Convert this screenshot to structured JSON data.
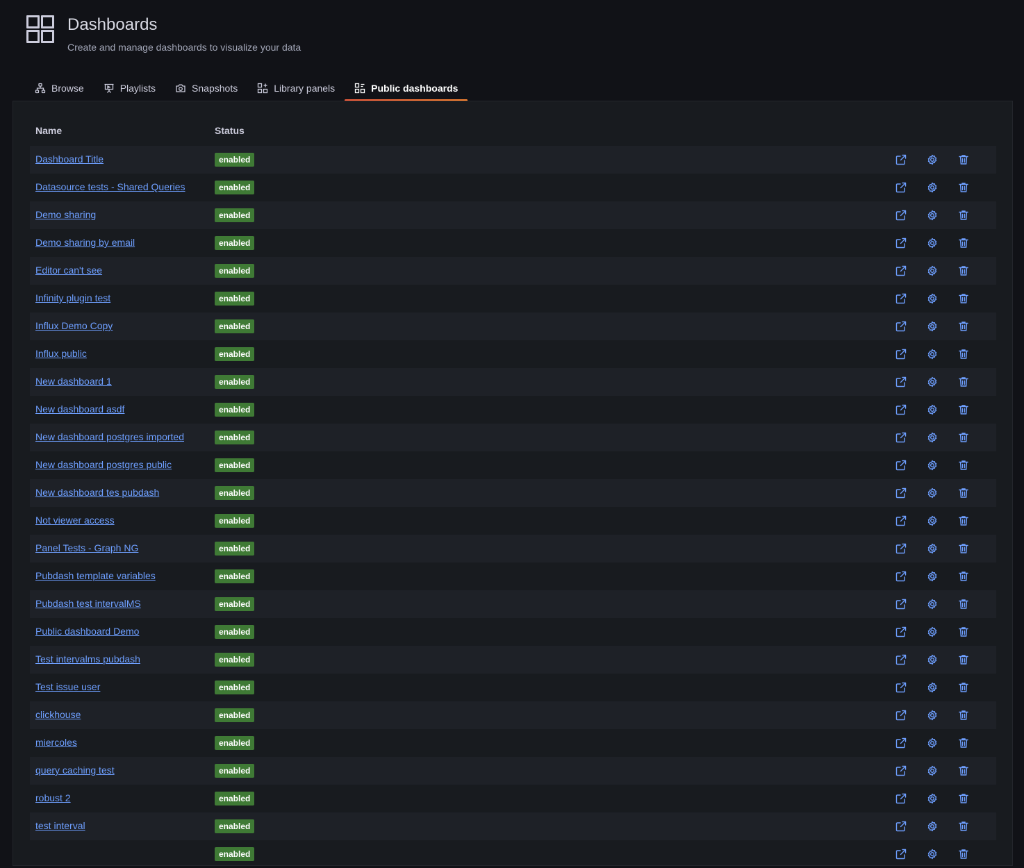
{
  "header": {
    "title": "Dashboards",
    "subtitle": "Create and manage dashboards to visualize your data",
    "icon": "apps-grid-icon"
  },
  "tabs": [
    {
      "label": "Browse",
      "icon": "sitemap-icon",
      "active": false
    },
    {
      "label": "Playlists",
      "icon": "presentation-icon",
      "active": false
    },
    {
      "label": "Snapshots",
      "icon": "camera-icon",
      "active": false
    },
    {
      "label": "Library panels",
      "icon": "library-panel-icon",
      "active": false
    },
    {
      "label": "Public dashboards",
      "icon": "public-dashboard-icon",
      "active": true
    }
  ],
  "table": {
    "columns": {
      "name": "Name",
      "status": "Status"
    },
    "rows": [
      {
        "name": "Dashboard Title",
        "status": "enabled"
      },
      {
        "name": "Datasource tests - Shared Queries",
        "status": "enabled"
      },
      {
        "name": "Demo sharing",
        "status": "enabled"
      },
      {
        "name": "Demo sharing by email",
        "status": "enabled"
      },
      {
        "name": "Editor can't see",
        "status": "enabled"
      },
      {
        "name": "Infinity plugin test",
        "status": "enabled"
      },
      {
        "name": "Influx Demo Copy",
        "status": "enabled"
      },
      {
        "name": "Influx public",
        "status": "enabled"
      },
      {
        "name": "New dashboard 1",
        "status": "enabled"
      },
      {
        "name": "New dashboard asdf",
        "status": "enabled"
      },
      {
        "name": "New dashboard postgres imported",
        "status": "enabled"
      },
      {
        "name": "New dashboard postgres public",
        "status": "enabled"
      },
      {
        "name": "New dashboard tes pubdash",
        "status": "enabled"
      },
      {
        "name": "Not viewer access",
        "status": "enabled"
      },
      {
        "name": "Panel Tests - Graph NG",
        "status": "enabled"
      },
      {
        "name": "Pubdash template variables",
        "status": "enabled"
      },
      {
        "name": "Pubdash test intervalMS",
        "status": "enabled"
      },
      {
        "name": "Public dashboard Demo",
        "status": "enabled"
      },
      {
        "name": "Test intervalms pubdash",
        "status": "enabled"
      },
      {
        "name": "Test issue user",
        "status": "enabled"
      },
      {
        "name": "clickhouse",
        "status": "enabled"
      },
      {
        "name": "miercoles",
        "status": "enabled"
      },
      {
        "name": "query caching test",
        "status": "enabled"
      },
      {
        "name": "robust 2",
        "status": "enabled"
      },
      {
        "name": "test interval",
        "status": "enabled"
      },
      {
        "name": "",
        "status": "enabled"
      }
    ],
    "row_actions": [
      "external-link-icon",
      "gear-icon",
      "trash-icon"
    ]
  },
  "colors": {
    "link": "#6e9fff",
    "badge": "#3f7a35",
    "accent": "#f55f3e"
  }
}
